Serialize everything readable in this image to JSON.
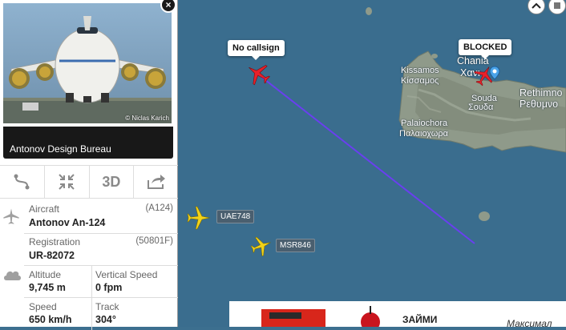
{
  "sidebar": {
    "photo_credit": "© Niclas Karich",
    "close_glyph": "×",
    "operator": "Antonov Design Bureau",
    "tools": [
      {
        "icon": "route-icon"
      },
      {
        "icon": "collapse-icon"
      },
      {
        "label": "3D"
      },
      {
        "icon": "share-icon"
      }
    ],
    "aircraft": {
      "label": "Aircraft",
      "code": "(A124)",
      "value": "Antonov An-124"
    },
    "registration": {
      "label": "Registration",
      "code": "(50801F)",
      "value": "UR-82072"
    },
    "altitude": {
      "label": "Altitude",
      "value": "9,745 m"
    },
    "vertical_speed": {
      "label": "Vertical Speed",
      "value": "0 fpm"
    },
    "speed": {
      "label": "Speed",
      "value": "650 km/h"
    },
    "track": {
      "label": "Track",
      "value": "304°"
    }
  },
  "map": {
    "places": {
      "kissamos": "Kissamos",
      "kissamos_gr": "Κίσσαμος",
      "chania": "Chania",
      "chania_gr": "Χανι",
      "souda": "Souda",
      "souda_gr": "Σουδα",
      "rethimno": "Rethimno",
      "rethimno_gr": "Ρεθυμνο",
      "palaiochora": "Palaiochora",
      "palaiochora_gr": "Παλαιοχωρα"
    },
    "callouts": {
      "selected": "No callsign",
      "blocked": "BLOCKED"
    },
    "flights": [
      {
        "callsign": "UAE748"
      },
      {
        "callsign": "MSR846"
      }
    ],
    "colors": {
      "selected_plane": "#e8202a",
      "other_plane": "#f2d21a",
      "track_line": "#6a3ff0",
      "sea": "#3a6d8e"
    },
    "ad": {
      "text": "ЗАЙМИ",
      "text2": "Максимал"
    }
  }
}
